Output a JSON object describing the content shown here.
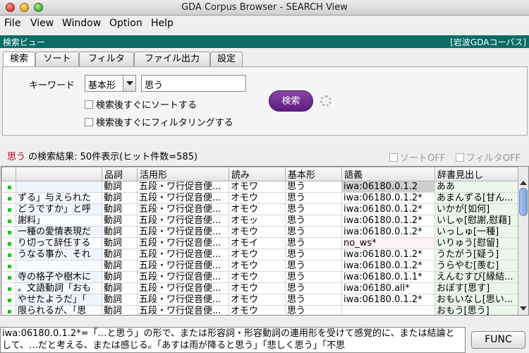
{
  "window": {
    "title": "GDA Corpus Browser - SEARCH View"
  },
  "menu": [
    "File",
    "View",
    "Window",
    "Option",
    "Help"
  ],
  "viewbar": {
    "left": "検索ビュー",
    "right": "[岩波GDAコーパス]"
  },
  "tabs": [
    "検索",
    "ソート",
    "フィルタ",
    "ファイル出力",
    "設定"
  ],
  "search": {
    "keyword_label": "キーワード",
    "form_select": "基本形",
    "keyword_value": "思う",
    "sort_after": "検索後すぐにソートする",
    "filter_after": "検索後すぐにフィルタリングする",
    "button": "検索"
  },
  "results": {
    "keyword": "思う",
    "summary": " の検索結果: 50件表示(ヒット件数=585)",
    "sort_off": "ソートOFF",
    "filter_off": "フィルタOFF"
  },
  "table": {
    "headers": [
      "",
      "",
      "品詞",
      "活用形",
      "読み",
      "基本形",
      "語義",
      "辞書見出し"
    ],
    "rows": [
      {
        "ctx": "",
        "pos": "動詞",
        "conj": "五段・ワ行促音便...",
        "reading": "オモワ",
        "base": "思う",
        "sense": "iwa:06180.0.1.2",
        "dict": "ああ"
      },
      {
        "ctx": "ずる」与えられた",
        "pos": "動詞",
        "conj": "五段・ワ行促音便...",
        "reading": "オモウ",
        "base": "思う",
        "sense": "iwa:06180.0.1.2*",
        "dict": "あまんずる[甘ん..."
      },
      {
        "ctx": "どうですか」と呼",
        "pos": "動詞",
        "conj": "五段・ワ行促音便...",
        "reading": "オモウ",
        "base": "思う",
        "sense": "iwa:06180.0.1.2*",
        "dict": "いかが[如何]"
      },
      {
        "ctx": "謝料」",
        "pos": "動詞",
        "conj": "五段・ワ行促音便...",
        "reading": "オモッ",
        "base": "思う",
        "sense": "iwa:06180.0.1.2*",
        "dict": "いしゃ[慰謝,慰藉]"
      },
      {
        "ctx": "一種の愛情表現だ",
        "pos": "動詞",
        "conj": "五段・ワ行促音便...",
        "reading": "オモウ",
        "base": "思う",
        "sense": "iwa:06180.0.1.2*",
        "dict": "いっしゅ[一種]"
      },
      {
        "ctx": "り切って辞任する",
        "pos": "動詞",
        "conj": "五段・ワ行促音便...",
        "reading": "オモイ",
        "base": "思う",
        "sense": "no_ws*",
        "dict": "いりゅう[慰留]"
      },
      {
        "ctx": "うなる事か、それ",
        "pos": "動詞",
        "conj": "五段・ワ行促音便...",
        "reading": "オモウ",
        "base": "思う",
        "sense": "iwa:06180.0.1.2*",
        "dict": "うたがう[疑う]"
      },
      {
        "ctx": "",
        "pos": "動詞",
        "conj": "五段・ワ行促音便...",
        "reading": "オモウ",
        "base": "思う",
        "sense": "iwa:06180.0.1.2*",
        "dict": "うらやむ[羨む]"
      },
      {
        "ctx": "寺の格子や樹木に",
        "pos": "動詞",
        "conj": "五段・ワ行促音便...",
        "reading": "オモウ",
        "base": "思う",
        "sense": "iwa:06180.0.1.1*",
        "dict": "えんむすび[縁結..."
      },
      {
        "ctx": "。文語動詞「おも",
        "pos": "動詞",
        "conj": "五段・ワ行促音便...",
        "reading": "オモウ",
        "base": "思う",
        "sense": "iwa:06180.all*",
        "dict": "おぼす[思す]"
      },
      {
        "ctx": "やせたようだ」「",
        "pos": "動詞",
        "conj": "五段・ワ行促音便...",
        "reading": "オモウ",
        "base": "思う",
        "sense": "iwa:06180.0.1.2*",
        "dict": "おもいなし[思い..."
      },
      {
        "ctx": "限られるが、「思",
        "pos": "動詞",
        "conj": "五段・ワ行促音便...",
        "reading": "オモウ",
        "base": "思う",
        "sense": "",
        "dict": "おもう[思う]"
      }
    ]
  },
  "description": "iwa:06180.0.1.2*=「…と思う」の形で、または形容詞・形容動詞の連用形を受けて感覚的に、または結論として、…だと考える、または感じる。「あすは雨が降ると思う」「悲しく思う」「不思",
  "func_button": "FUNC",
  "colors": {
    "viewbar": "#096b64",
    "search_button": "#6a2a8c",
    "keyword": "#c0001a",
    "row_marker": "#18c618"
  }
}
